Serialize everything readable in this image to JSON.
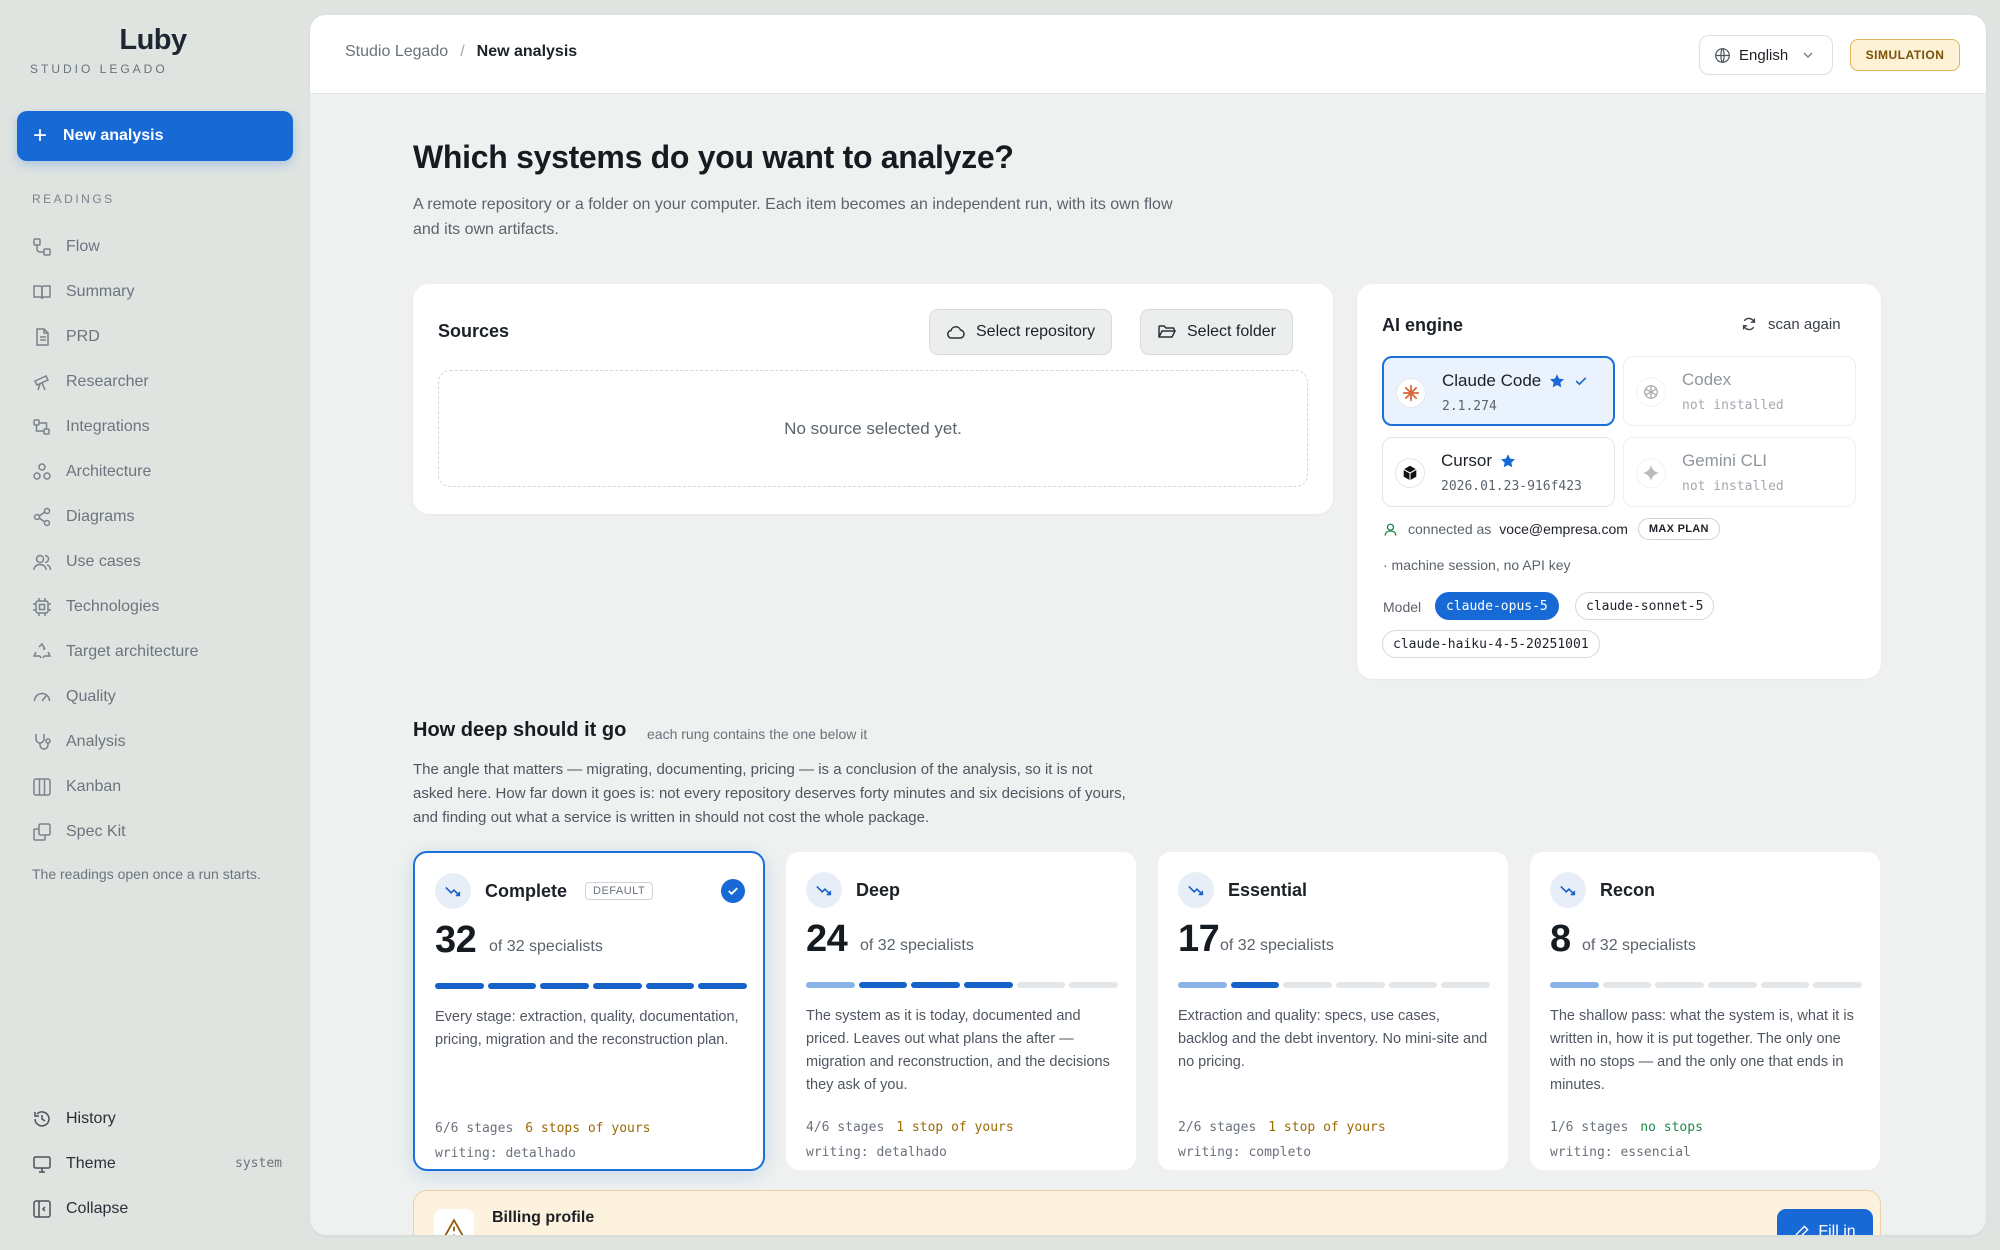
{
  "brand": {
    "logo": "Luby",
    "subtitle": "STUDIO LEGADO"
  },
  "sidebar": {
    "new_button": "New analysis",
    "section_label": "READINGS",
    "items": [
      {
        "label": "Flow",
        "icon": "flow-icon"
      },
      {
        "label": "Summary",
        "icon": "book-icon"
      },
      {
        "label": "PRD",
        "icon": "document-icon"
      },
      {
        "label": "Researcher",
        "icon": "telescope-icon"
      },
      {
        "label": "Integrations",
        "icon": "integrations-icon"
      },
      {
        "label": "Architecture",
        "icon": "architecture-icon"
      },
      {
        "label": "Diagrams",
        "icon": "share-nodes-icon"
      },
      {
        "label": "Use cases",
        "icon": "users-icon"
      },
      {
        "label": "Technologies",
        "icon": "chip-icon"
      },
      {
        "label": "Target architecture",
        "icon": "recycle-icon"
      },
      {
        "label": "Quality",
        "icon": "gauge-icon"
      },
      {
        "label": "Analysis",
        "icon": "stethoscope-icon"
      },
      {
        "label": "Kanban",
        "icon": "kanban-icon"
      },
      {
        "label": "Spec Kit",
        "icon": "copy-icon"
      }
    ],
    "note": "The readings open once a run starts.",
    "bottom": {
      "history": "History",
      "theme": "Theme",
      "theme_value": "system",
      "collapse": "Collapse"
    }
  },
  "topbar": {
    "breadcrumb_root": "Studio Legado",
    "breadcrumb_sep": "/",
    "breadcrumb_current": "New analysis",
    "language": "English",
    "mode_badge": "SIMULATION"
  },
  "page": {
    "title": "Which systems do you want to analyze?",
    "lead": "A remote repository or a folder on your computer. Each item becomes an independent run, with its own flow and its own artifacts."
  },
  "sources": {
    "title": "Sources",
    "select_repo": "Select repository",
    "select_folder": "Select folder",
    "empty": "No source selected yet."
  },
  "engine": {
    "title": "AI engine",
    "rescan": "scan again",
    "engines": [
      {
        "name": "Claude Code",
        "version": "2.1.274",
        "selected": true,
        "installed": true
      },
      {
        "name": "Codex",
        "version": "not installed",
        "selected": false,
        "installed": false
      },
      {
        "name": "Cursor",
        "version": "2026.01.23-916f423",
        "selected": false,
        "installed": true
      },
      {
        "name": "Gemini CLI",
        "version": "not installed",
        "selected": false,
        "installed": false
      }
    ],
    "connected_label": "connected as",
    "email": "voce@empresa.com",
    "plan": "MAX PLAN",
    "session_note": "· machine session, no API key",
    "model_label": "Model",
    "models": [
      "claude-opus-5",
      "claude-sonnet-5",
      "claude-haiku-4-5-20251001"
    ],
    "selected_model": "claude-opus-5"
  },
  "depth": {
    "title": "How deep should it go",
    "note": "each rung contains the one below it",
    "description": "The angle that matters — migrating, documenting, pricing — is a conclusion of the analysis, so it is not asked here. How far down it goes is: not every repository deserves forty minutes and six decisions of yours, and finding out what a service is written in should not cost the whole package.",
    "levels": [
      {
        "name": "Complete",
        "badge": "DEFAULT",
        "count": "32",
        "of": "of 32 specialists",
        "specialists": 32,
        "total": 32,
        "desc": "Every stage: extraction, quality, documentation, pricing, migration and the reconstruction plan.",
        "stages": "6/6 stages",
        "stops": "6 stops of yours",
        "writing": "writing: detalhado"
      },
      {
        "name": "Deep",
        "badge": "",
        "count": "24",
        "of": "of 32 specialists",
        "specialists": 24,
        "total": 32,
        "desc": "The system as it is today, documented and priced. Leaves out what plans the after — migration and reconstruction, and the decisions they ask of you.",
        "stages": "4/6 stages",
        "stops": "1 stop of yours",
        "writing": "writing: detalhado"
      },
      {
        "name": "Essential",
        "badge": "",
        "count": "17",
        "of": "of 32 specialists",
        "specialists": 17,
        "total": 32,
        "desc": "Extraction and quality: specs, use cases, backlog and the debt inventory. No mini-site and no pricing.",
        "stages": "2/6 stages",
        "stops": "1 stop of yours",
        "writing": "writing: completo"
      },
      {
        "name": "Recon",
        "badge": "",
        "count": "8",
        "of": "of 32 specialists",
        "specialists": 8,
        "total": 32,
        "desc": "The shallow pass: what the system is, what it is written in, how it is put together. The only one with no stops — and the only one that ends in minutes.",
        "stages": "1/6 stages",
        "stops": "no stops",
        "writing": "writing: essencial"
      }
    ]
  },
  "billing": {
    "title": "Billing profile",
    "button": "Fill in"
  },
  "colors": {
    "accent": "#1769d6",
    "warning_bg": "#fdf2dd",
    "stop_text": "#9b6a05",
    "nostop_text": "#1f8a4c"
  }
}
